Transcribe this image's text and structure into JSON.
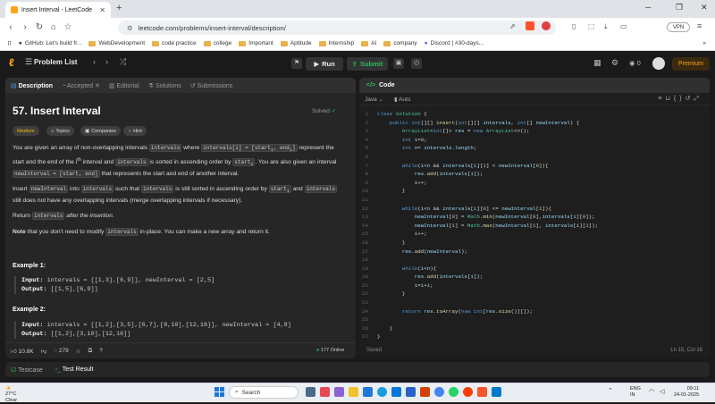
{
  "browser": {
    "tab_title": "Insert Interval - LeetCode",
    "url": "leetcode.com/problems/insert-interval/description/",
    "vpn": "VPN",
    "bookmarks": [
      "GitHub: Let's build fr...",
      "WebDevelopment",
      "code practice",
      "college",
      "Important",
      "Aptitude",
      "Internship",
      "AI",
      "company",
      "Discord | #30-days..."
    ]
  },
  "nav": {
    "problem_list": "Problem List",
    "run": "Run",
    "submit": "Submit",
    "coins": "0",
    "premium": "Premium"
  },
  "left": {
    "tabs": [
      "Description",
      "Accepted",
      "Editorial",
      "Solutions",
      "Submissions"
    ],
    "title": "57. Insert Interval",
    "solved": "Solved",
    "chips": [
      "Medium",
      "Topics",
      "Companies",
      "Hint"
    ],
    "desc": {
      "p1a": "You are given an array of non-overlapping intervals ",
      "p1b": "intervals",
      "p1c": " where ",
      "p1d": "intervals[i] = [start",
      "p1e": ", end",
      "p1f": "]",
      "p1g": " represent the start and the end of the ",
      "p1h": " interval and ",
      "p1i": "intervals",
      "p1j": " is sorted in ascending order by ",
      "p1k": "start",
      "p1l": ". You are also given an interval ",
      "p1m": "newInterval = [start, end]",
      "p1n": " that represents the start and end of another interval.",
      "p2a": "Insert ",
      "p2b": "newInterval",
      "p2c": " into ",
      "p2d": "intervals",
      "p2e": " such that ",
      "p2f": "intervals",
      "p2g": " is still sorted in ascending order by ",
      "p2h": "start",
      "p2i": " and ",
      "p2j": "intervals",
      "p2k": " still does not have any overlapping intervals (merge overlapping intervals if necessary).",
      "p3a": "Return ",
      "p3b": "intervals",
      "p3c": " after the insertion.",
      "p4a": "Note",
      "p4b": " that you don't need to modify ",
      "p4c": "intervals",
      "p4d": " in-place. You can make a new array and return it."
    },
    "ex1_title": "Example 1:",
    "ex1_input_label": "Input:",
    "ex1_input": " intervals = [[1,3],[6,9]], newInterval = [2,5]",
    "ex1_output_label": "Output:",
    "ex1_output": " [[1,5],[6,9]]",
    "ex2_title": "Example 2:",
    "ex2_input_label": "Input:",
    "ex2_input": " intervals = [[1,2],[3,5],[6,7],[8,10],[12,16]], newInterval = [4,8]",
    "ex2_output_label": "Output:",
    "ex2_output": " [[1,2],[3,10],[12,16]]",
    "likes": "10.8K",
    "comments": "279",
    "online": "177 Online"
  },
  "right": {
    "code_tab": "Code",
    "lang": "Java",
    "auto": "Auto",
    "saved": "Saved",
    "cursor": "Ln 15, Col 16"
  },
  "bottom": {
    "testcase": "Testcase",
    "result": "Test Result"
  },
  "taskbar": {
    "temp": "27°C",
    "weather": "Clear",
    "search": "Search",
    "lang1": "ENG",
    "lang2": "IN",
    "time": "09:11",
    "date": "24-01-2025"
  }
}
